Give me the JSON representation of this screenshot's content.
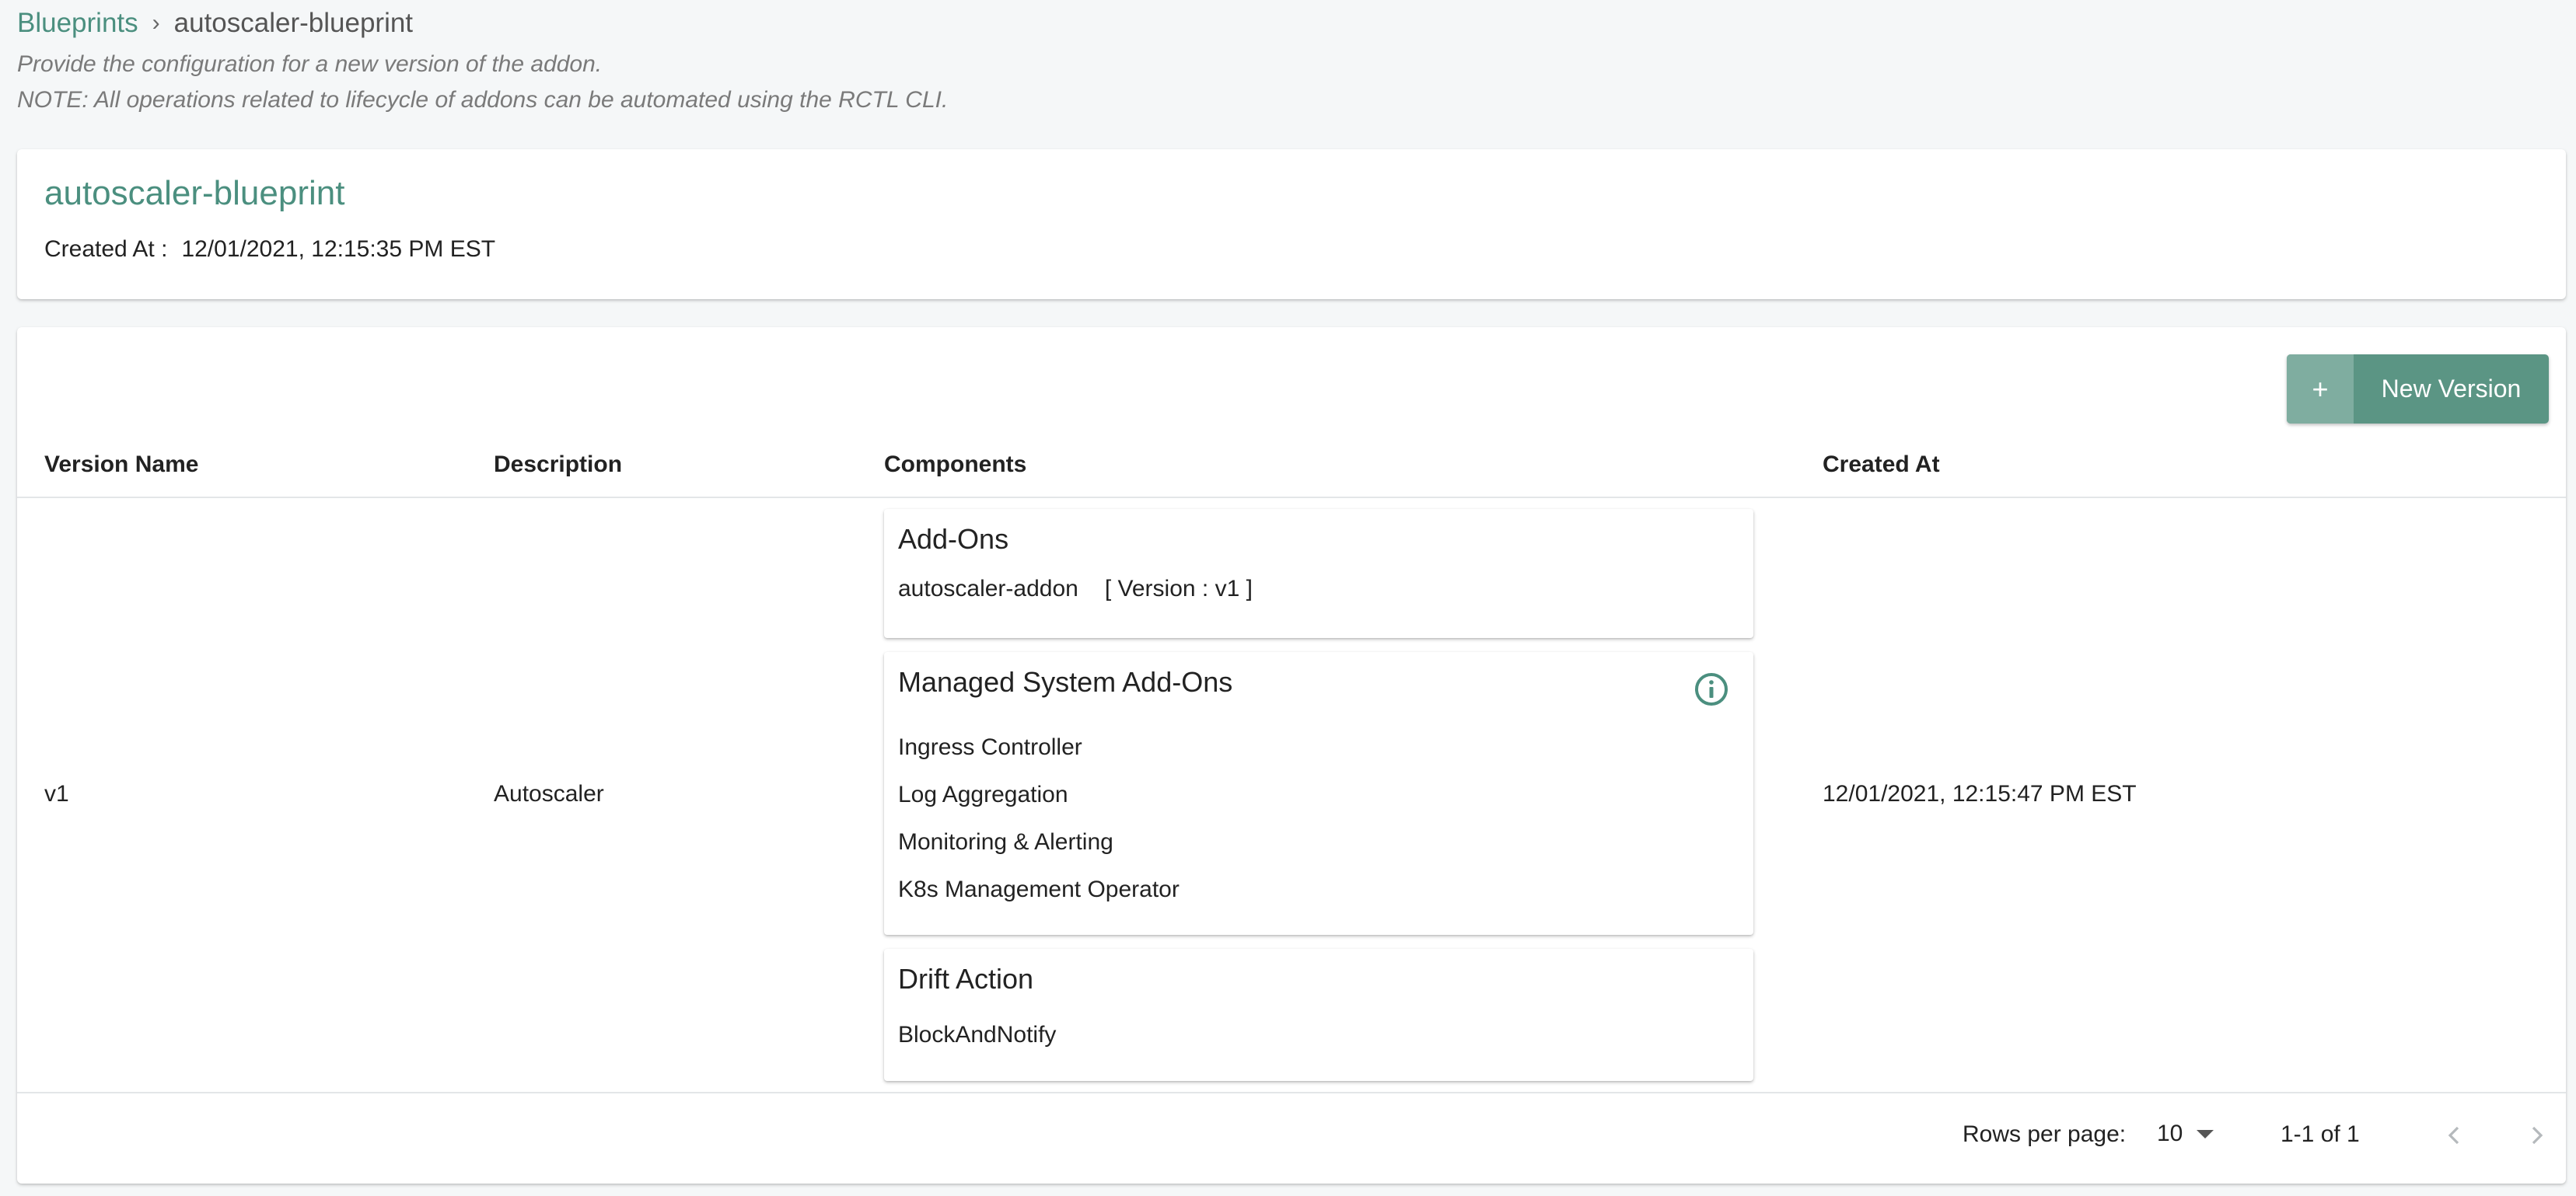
{
  "breadcrumb": {
    "root": "Blueprints",
    "separator": "›",
    "current": "autoscaler-blueprint"
  },
  "hints": {
    "line1": "Provide the configuration for a new version of the addon.",
    "line2": "NOTE: All operations related to lifecycle of addons can be automated using the RCTL CLI."
  },
  "header_card": {
    "title": "autoscaler-blueprint",
    "created_label": "Created At :",
    "created_value": "12/01/2021, 12:15:35 PM EST"
  },
  "toolbar": {
    "new_version_icon": "+",
    "new_version_label": "New Version"
  },
  "table": {
    "columns": [
      "Version Name",
      "Description",
      "Components",
      "Created At"
    ],
    "rows": [
      {
        "version": "v1",
        "description": "Autoscaler",
        "created_at": "12/01/2021, 12:15:47 PM EST",
        "components": {
          "addons": {
            "title": "Add-Ons",
            "items": [
              {
                "name": "autoscaler-addon",
                "version": "[ Version : v1 ]"
              }
            ]
          },
          "managed": {
            "title": "Managed System Add-Ons",
            "info_icon": "info-circle-icon",
            "items": [
              "Ingress Controller",
              "Log Aggregation",
              "Monitoring & Alerting",
              "K8s Management Operator"
            ]
          },
          "drift": {
            "title": "Drift Action",
            "value": "BlockAndNotify"
          }
        }
      }
    ]
  },
  "pagination": {
    "rows_per_page_label": "Rows per page:",
    "rows_per_page_value": "10",
    "range": "1-1 of 1"
  },
  "colors": {
    "accent": "#4b8f7f",
    "button": "#5b9584",
    "button_icon_bg": "#7fada0",
    "background": "#f5f7f8"
  }
}
